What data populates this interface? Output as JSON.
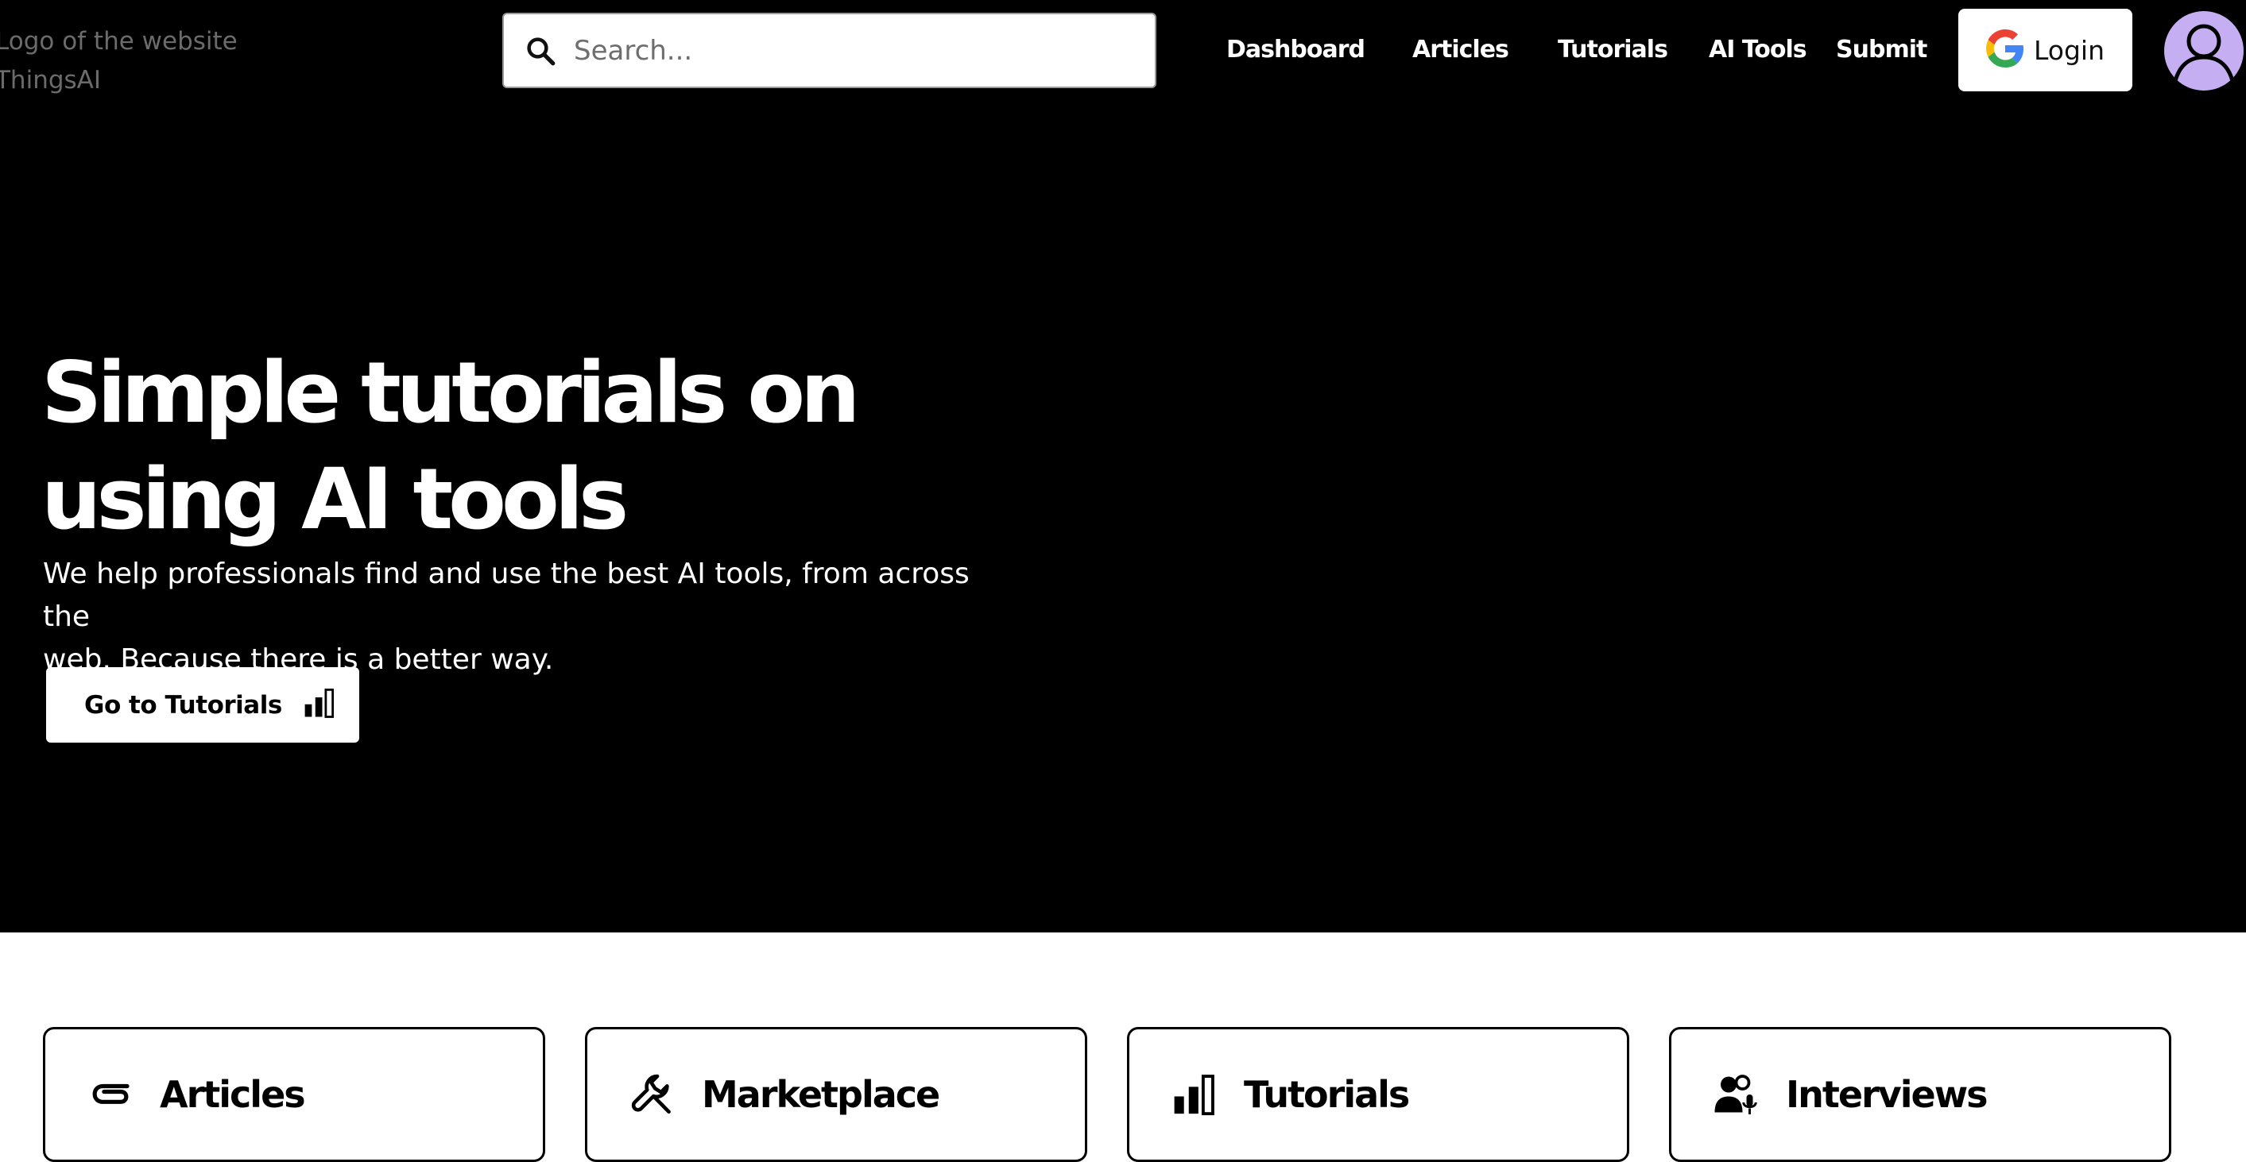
{
  "header": {
    "logo_alt_line1": "Logo of the website",
    "logo_alt_line2": "ThingsAI",
    "search": {
      "placeholder": "Search..."
    },
    "nav": [
      {
        "label": "Dashboard"
      },
      {
        "label": "Articles"
      },
      {
        "label": "Tutorials"
      },
      {
        "label": "AI Tools"
      },
      {
        "label": "Submit"
      }
    ],
    "login_label": "Login"
  },
  "hero": {
    "title_line1": "Simple tutorials on",
    "title_line2": "using AI tools",
    "subtitle_line1": "We help professionals find and use the best AI tools, from across the",
    "subtitle_line2": "web. Because there is a better way.",
    "cta_label": "Go to Tutorials"
  },
  "cards": [
    {
      "label": "Articles",
      "icon": "paperclip-icon"
    },
    {
      "label": "Marketplace",
      "icon": "wrench-icon"
    },
    {
      "label": "Tutorials",
      "icon": "bar-chart-icon"
    },
    {
      "label": "Interviews",
      "icon": "people-microphone-icon"
    }
  ],
  "colors": {
    "hero_background": "#000000",
    "avatar_background": "#c6aef2",
    "logo_text": "#6b6b6b",
    "text_on_dark": "#ffffff"
  }
}
